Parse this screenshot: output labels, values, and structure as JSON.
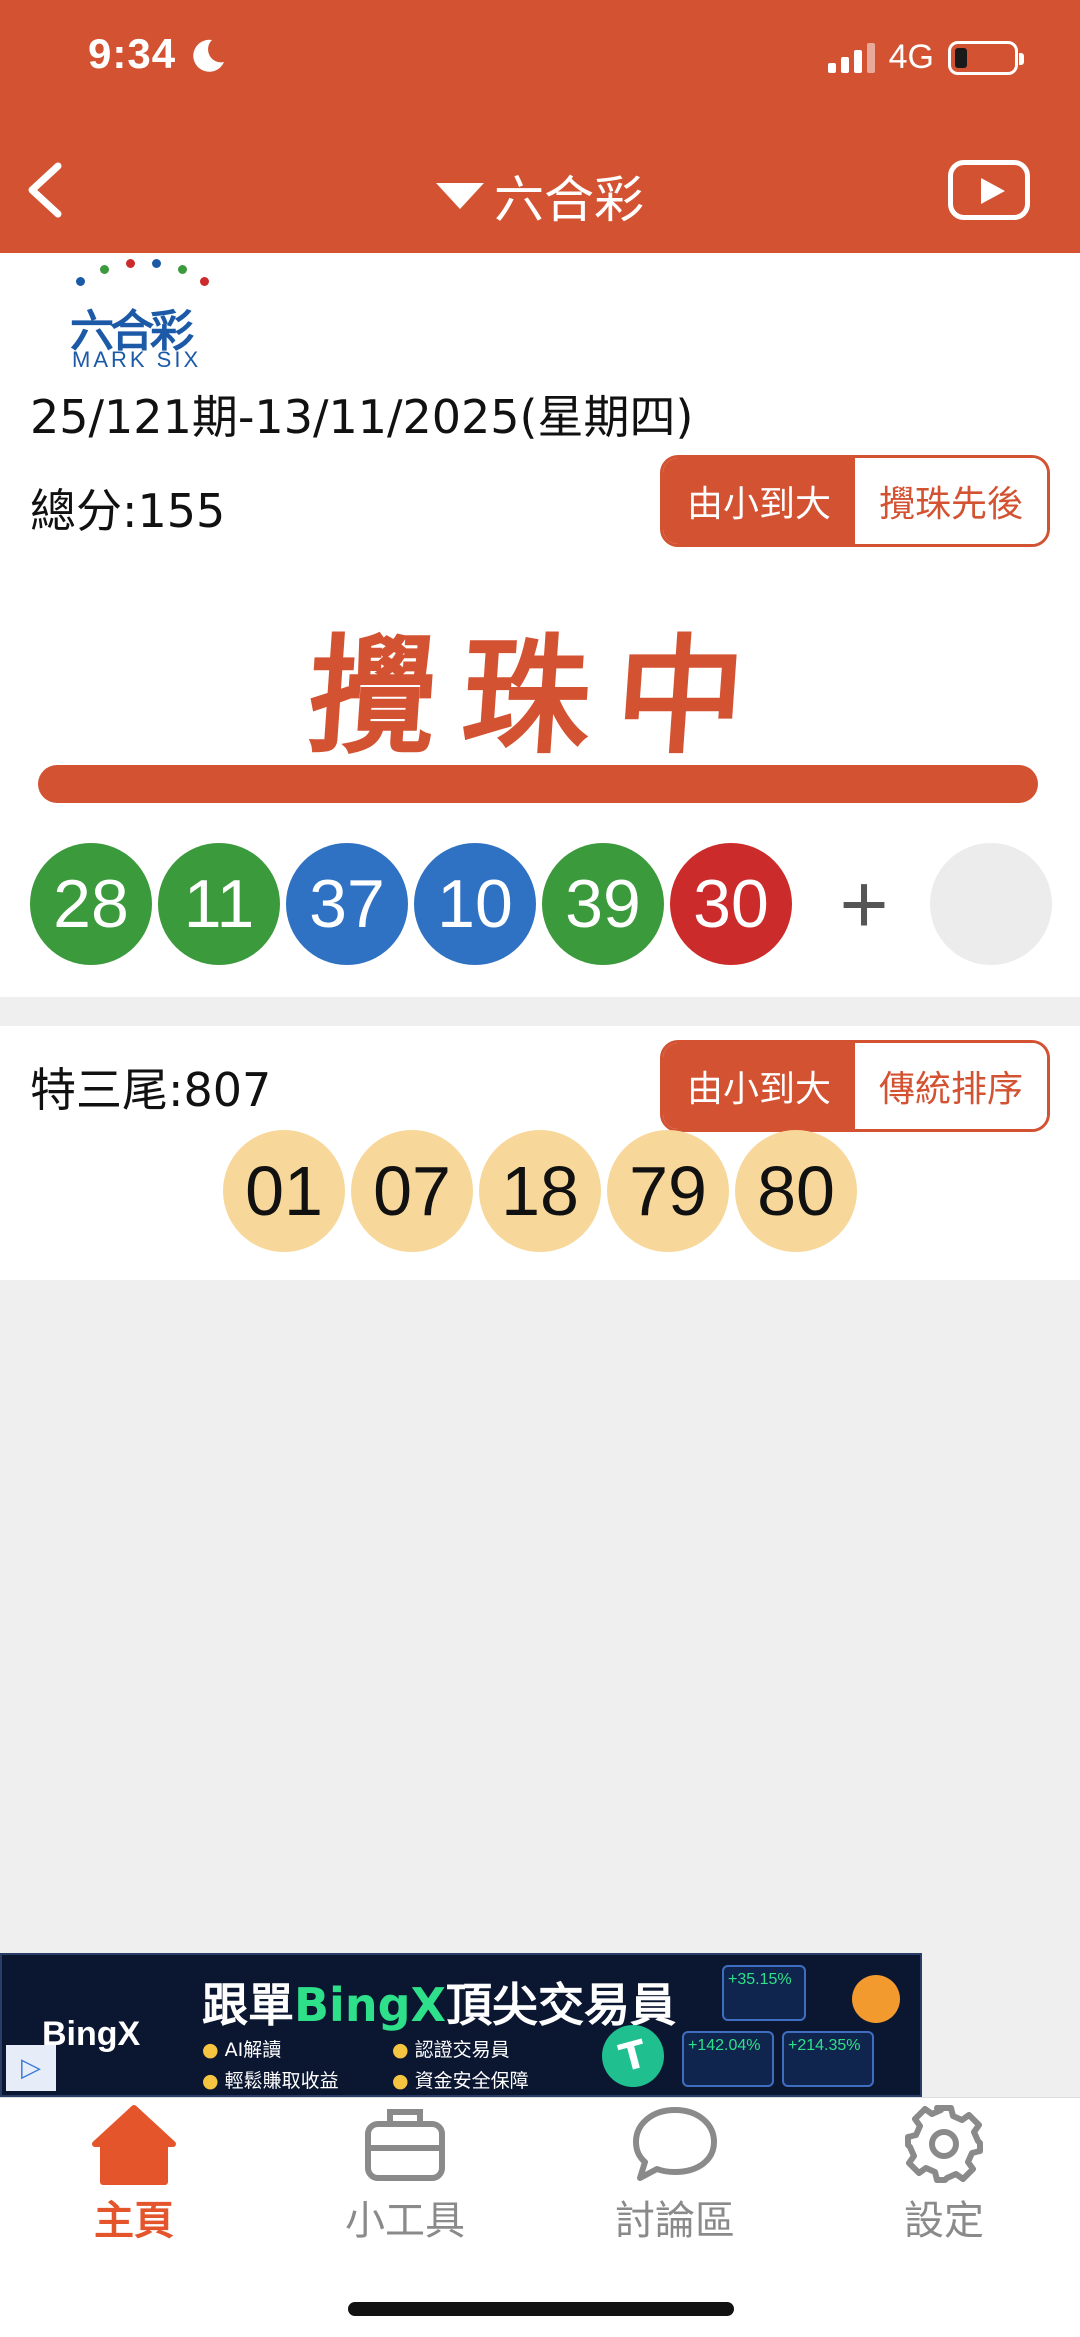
{
  "status": {
    "time": "9:34",
    "network": "4G"
  },
  "nav": {
    "title": "六合彩"
  },
  "logo": {
    "cn": "六合彩",
    "en": "MARK SIX"
  },
  "draw": {
    "info": "25/121期-13/11/2025(星期四)",
    "total": "總分:155",
    "sort_small_to_big": "由小到大",
    "sort_draw_order": "攪珠先後",
    "drawing_text": "攪珠中",
    "balls": [
      {
        "number": "28",
        "color": "green"
      },
      {
        "number": "11",
        "color": "green"
      },
      {
        "number": "37",
        "color": "blue"
      },
      {
        "number": "10",
        "color": "blue"
      },
      {
        "number": "39",
        "color": "green"
      },
      {
        "number": "30",
        "color": "red"
      }
    ],
    "plus": "+"
  },
  "tail": {
    "label": "特三尾:807",
    "sort_small_to_big": "由小到大",
    "sort_traditional": "傳統排序",
    "numbers": [
      "01",
      "07",
      "18",
      "79",
      "80"
    ]
  },
  "ad": {
    "brand": "BingX",
    "head_prefix": "跟單",
    "head_highlight": "BingX",
    "head_suffix": "頂尖交易員",
    "features": [
      "AI解讀",
      "認證交易員",
      "輕鬆賺取收益",
      "資金安全保障"
    ],
    "stats": [
      "+35.15%",
      "+142.04%",
      "+214.35%"
    ]
  },
  "tabs": [
    {
      "label": "主頁",
      "icon": "home-icon",
      "active": true
    },
    {
      "label": "小工具",
      "icon": "toolbox-icon",
      "active": false
    },
    {
      "label": "討論區",
      "icon": "chat-bubble-icon",
      "active": false
    },
    {
      "label": "設定",
      "icon": "gear-icon",
      "active": false
    }
  ],
  "colors": {
    "accent": "#d35232",
    "ball_green": "#3b9a3b",
    "ball_blue": "#2f72c4",
    "ball_red": "#cc2b2b",
    "tail_ball": "#f7d79a",
    "active_tab": "#e5552c"
  }
}
